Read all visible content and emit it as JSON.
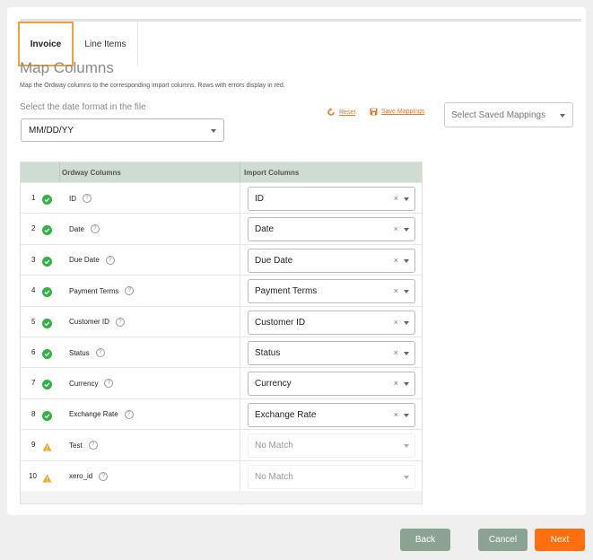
{
  "tabs": [
    {
      "label": "Invoice",
      "active": true
    },
    {
      "label": "Line Items",
      "active": false
    }
  ],
  "page": {
    "title": "Map Columns",
    "subtitle": "Map the Ordway columns to the corresponding import columns. Rows with errors display in red."
  },
  "date_format": {
    "label": "Select the date format in the file",
    "value": "MM/DD/YY"
  },
  "actions": {
    "reset": "Reset",
    "save_mappings": "Save Mappings",
    "saved_mappings_placeholder": "Select Saved Mappings"
  },
  "table": {
    "headers": [
      "Ordway Columns",
      "Import Columns"
    ],
    "rows": [
      {
        "num": "1",
        "status": "ok",
        "name": "ID",
        "import": "ID"
      },
      {
        "num": "2",
        "status": "ok",
        "name": "Date",
        "import": "Date"
      },
      {
        "num": "3",
        "status": "ok",
        "name": "Due Date",
        "import": "Due Date"
      },
      {
        "num": "4",
        "status": "ok",
        "name": "Payment Terms",
        "import": "Payment Terms"
      },
      {
        "num": "5",
        "status": "ok",
        "name": "Customer ID",
        "import": "Customer ID"
      },
      {
        "num": "6",
        "status": "ok",
        "name": "Status",
        "import": "Status"
      },
      {
        "num": "7",
        "status": "ok",
        "name": "Currency",
        "import": "Currency"
      },
      {
        "num": "8",
        "status": "ok",
        "name": "Exchange Rate",
        "import": "Exchange Rate"
      },
      {
        "num": "9",
        "status": "warning",
        "name": "Test",
        "import": "No Match"
      },
      {
        "num": "10",
        "status": "warning",
        "name": "xero_id",
        "import": "No Match"
      }
    ]
  },
  "buttons": {
    "back": "Back",
    "cancel": "Cancel",
    "next": "Next"
  },
  "colors": {
    "accent": "#ff6f0f",
    "header_bg": "#cfdcd3",
    "secondary_button": "#8ca293",
    "success": "#2fb344",
    "warning": "#f5a623"
  },
  "icons": {
    "ok": "check-circle-icon",
    "warning": "warning-triangle-icon",
    "help": "help-circle-icon",
    "reset": "reset-icon",
    "save": "save-icon"
  }
}
